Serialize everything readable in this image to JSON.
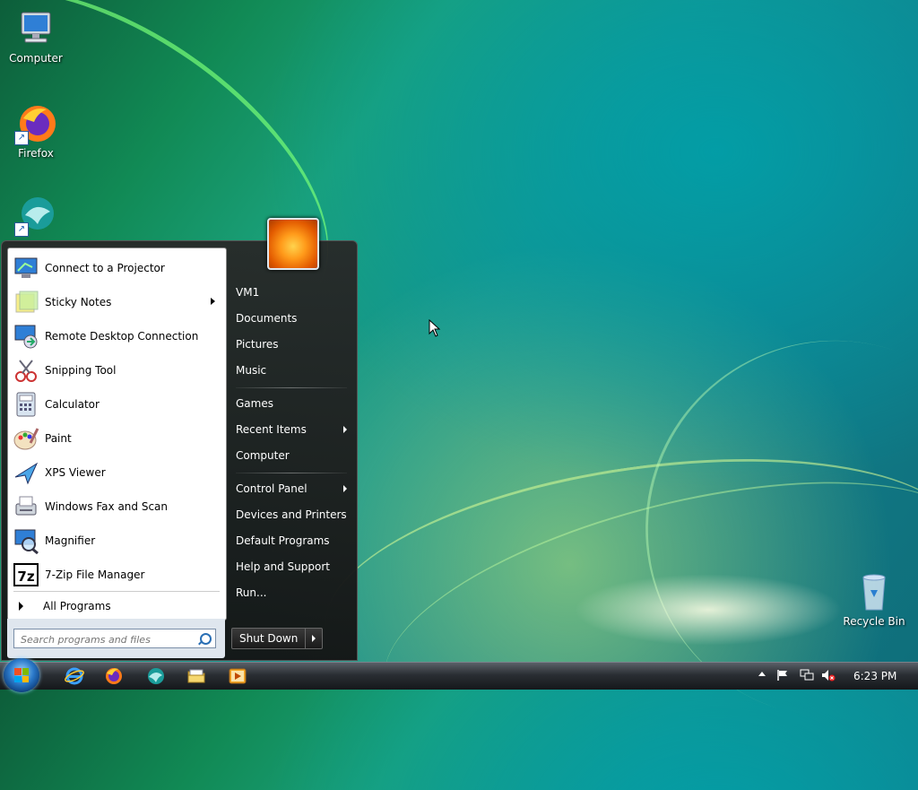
{
  "desktop": {
    "icons": [
      {
        "label": "Computer"
      },
      {
        "label": "Firefox"
      },
      {
        "label": ""
      },
      {
        "label": "Recycle Bin"
      }
    ]
  },
  "start_menu": {
    "programs": [
      {
        "label": "Connect to a Projector",
        "icon": "projector-icon"
      },
      {
        "label": "Sticky Notes",
        "icon": "sticky-notes-icon",
        "has_submenu": true
      },
      {
        "label": "Remote Desktop Connection",
        "icon": "remote-desktop-icon"
      },
      {
        "label": "Snipping Tool",
        "icon": "scissors-icon"
      },
      {
        "label": "Calculator",
        "icon": "calculator-icon"
      },
      {
        "label": "Paint",
        "icon": "paint-palette-icon"
      },
      {
        "label": "XPS Viewer",
        "icon": "xps-viewer-icon"
      },
      {
        "label": "Windows Fax and Scan",
        "icon": "fax-icon"
      },
      {
        "label": "Magnifier",
        "icon": "magnifier-icon"
      },
      {
        "label": "7-Zip File Manager",
        "icon": "7zip-icon"
      }
    ],
    "all_programs": "All Programs",
    "search_placeholder": "Search programs and files",
    "right_links": [
      {
        "label": "VM1"
      },
      {
        "label": "Documents"
      },
      {
        "label": "Pictures"
      },
      {
        "label": "Music"
      },
      {
        "label": "Games"
      },
      {
        "label": "Recent Items",
        "has_submenu": true
      },
      {
        "label": "Computer"
      },
      {
        "label": "Control Panel",
        "has_submenu": true
      },
      {
        "label": "Devices and Printers"
      },
      {
        "label": "Default Programs"
      },
      {
        "label": "Help and Support"
      },
      {
        "label": "Run..."
      }
    ],
    "shutdown_label": "Shut Down"
  },
  "taskbar": {
    "pinned": [
      "ie-icon",
      "firefox-icon",
      "bird-app-icon",
      "explorer-icon",
      "media-player-icon"
    ],
    "clock": "6:23 PM"
  }
}
